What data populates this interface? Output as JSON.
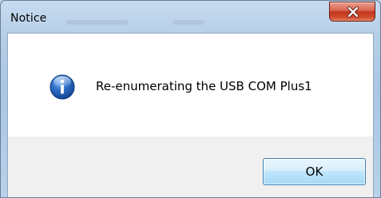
{
  "window": {
    "title": "Notice",
    "close_icon": "close-icon",
    "accent_color": "#c7371f"
  },
  "message": {
    "icon": "info-icon",
    "icon_color": "#2a5fb0",
    "text": "Re-enumerating the USB COM Plus1"
  },
  "buttons": {
    "ok_label": "OK"
  }
}
